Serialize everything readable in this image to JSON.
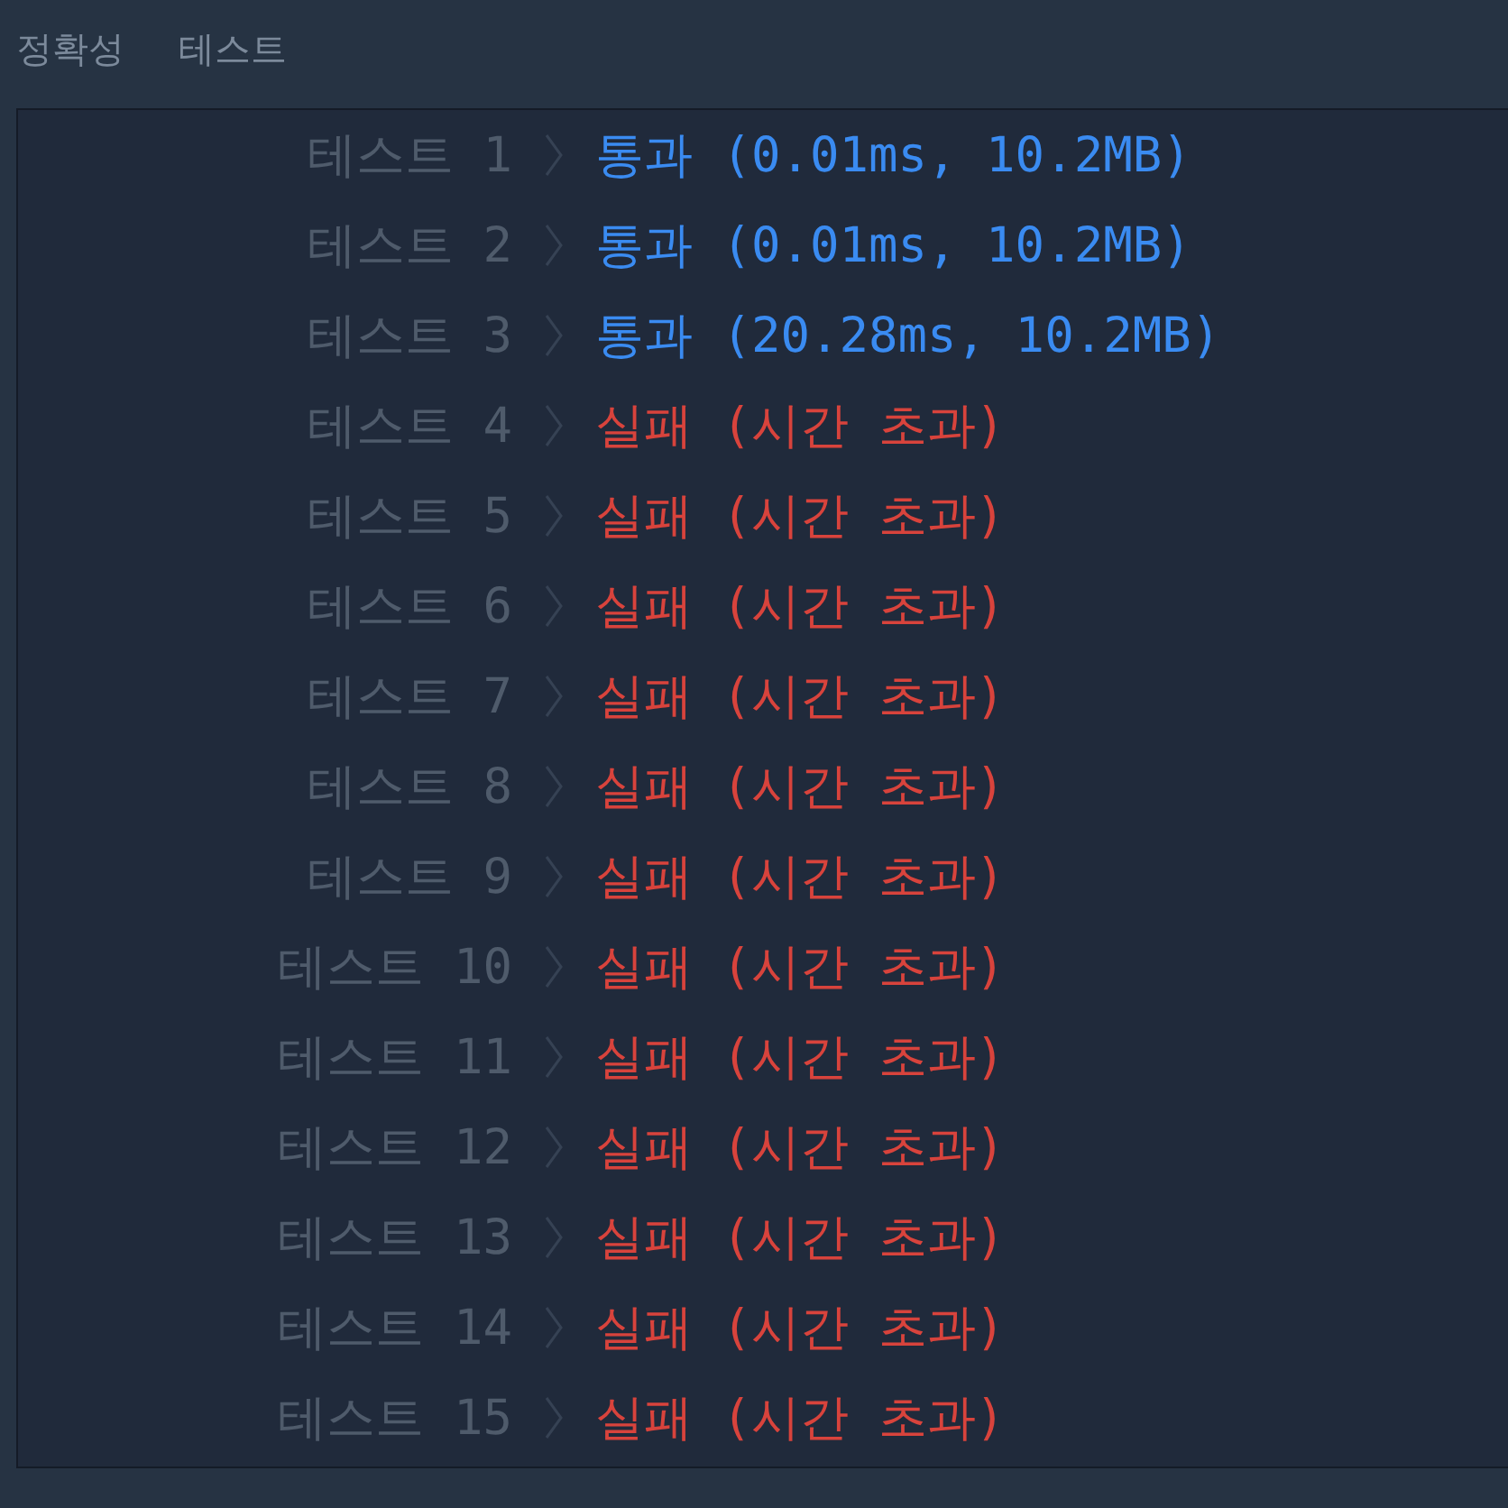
{
  "header": {
    "columns": [
      "정확성",
      "테스트"
    ]
  },
  "results": [
    {
      "label": "테스트 1",
      "kind": "pass",
      "result": "통과 (0.01ms, 10.2MB)"
    },
    {
      "label": "테스트 2",
      "kind": "pass",
      "result": "통과 (0.01ms, 10.2MB)"
    },
    {
      "label": "테스트 3",
      "kind": "pass",
      "result": "통과 (20.28ms, 10.2MB)"
    },
    {
      "label": "테스트 4",
      "kind": "fail",
      "result": "실패 (시간 초과)"
    },
    {
      "label": "테스트 5",
      "kind": "fail",
      "result": "실패 (시간 초과)"
    },
    {
      "label": "테스트 6",
      "kind": "fail",
      "result": "실패 (시간 초과)"
    },
    {
      "label": "테스트 7",
      "kind": "fail",
      "result": "실패 (시간 초과)"
    },
    {
      "label": "테스트 8",
      "kind": "fail",
      "result": "실패 (시간 초과)"
    },
    {
      "label": "테스트 9",
      "kind": "fail",
      "result": "실패 (시간 초과)"
    },
    {
      "label": "테스트 10",
      "kind": "fail",
      "result": "실패 (시간 초과)"
    },
    {
      "label": "테스트 11",
      "kind": "fail",
      "result": "실패 (시간 초과)"
    },
    {
      "label": "테스트 12",
      "kind": "fail",
      "result": "실패 (시간 초과)"
    },
    {
      "label": "테스트 13",
      "kind": "fail",
      "result": "실패 (시간 초과)"
    },
    {
      "label": "테스트 14",
      "kind": "fail",
      "result": "실패 (시간 초과)"
    },
    {
      "label": "테스트 15",
      "kind": "fail",
      "result": "실패 (시간 초과)"
    }
  ]
}
